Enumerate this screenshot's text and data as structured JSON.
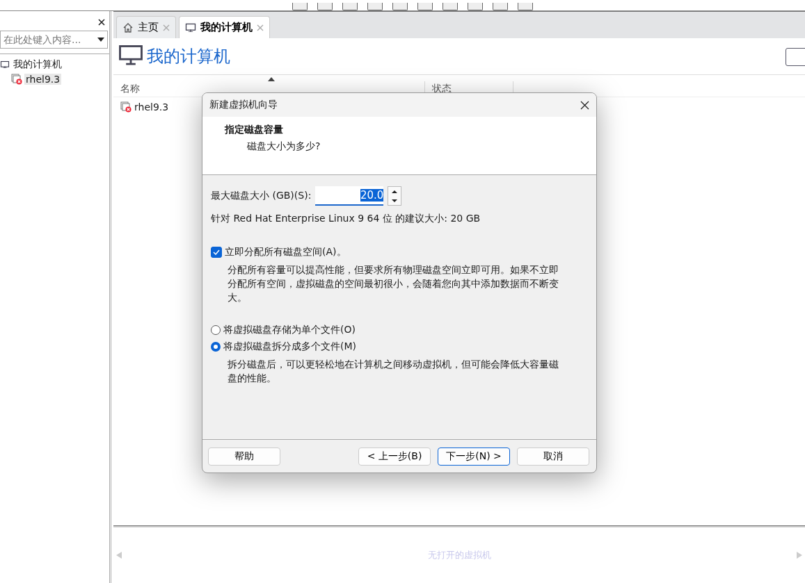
{
  "sidebar": {
    "search": {
      "placeholder": "在此处键入内容..."
    },
    "tree": [
      {
        "label": "我的计算机",
        "selected": false,
        "children": [
          {
            "label": "rhel9.3",
            "selected": true
          }
        ]
      }
    ]
  },
  "tabs": [
    {
      "label": "主页",
      "kind": "home",
      "selected": false
    },
    {
      "label": "我的计算机",
      "kind": "computer",
      "selected": true
    }
  ],
  "page": {
    "title": "我的计算机",
    "columns": [
      "名称",
      "状态"
    ],
    "rows": [
      {
        "name": "rhel9.3"
      }
    ]
  },
  "bottom_panel": {
    "message": "无打开的虚拟机"
  },
  "dialog": {
    "title": "新建虚拟机向导",
    "heading": "指定磁盘容量",
    "subheading": "磁盘大小为多少?",
    "size_label": "最大磁盘大小 (GB)(S):",
    "size_value": "20.0",
    "recommendation": "针对 Red Hat Enterprise Linux 9 64 位 的建议大小: 20 GB",
    "allocate": {
      "label": "立即分配所有磁盘空间(A)。",
      "checked": true,
      "description": "分配所有容量可以提高性能，但要求所有物理磁盘空间立即可用。如果不立即分配所有空间，虚拟磁盘的空间最初很小，会随着您向其中添加数据而不断变大。"
    },
    "options": [
      {
        "label": "将虚拟磁盘存储为单个文件(O)",
        "selected": false
      },
      {
        "label": "将虚拟磁盘拆分成多个文件(M)",
        "selected": true,
        "description": "拆分磁盘后，可以更轻松地在计算机之间移动虚拟机，但可能会降低大容量磁盘的性能。"
      }
    ],
    "buttons": [
      {
        "label": "帮助",
        "default": false
      },
      {
        "label": "< 上一步(B)",
        "default": false
      },
      {
        "label": "下一步(N) >",
        "default": true
      },
      {
        "label": "取消",
        "default": false
      }
    ]
  }
}
